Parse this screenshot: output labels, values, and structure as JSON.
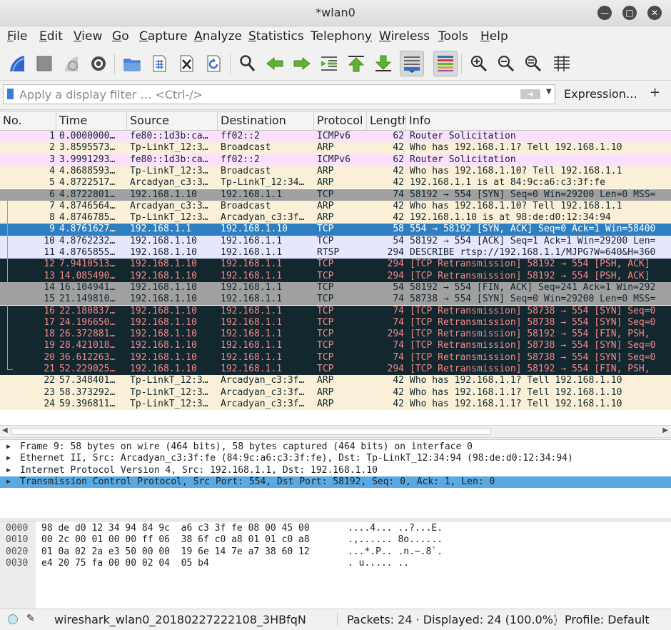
{
  "window": {
    "title": "*wlan0"
  },
  "menu": [
    {
      "label": "File",
      "u": "F",
      "rest": "ile"
    },
    {
      "label": "Edit",
      "u": "E",
      "rest": "dit"
    },
    {
      "label": "View",
      "u": "V",
      "rest": "iew"
    },
    {
      "label": "Go",
      "u": "G",
      "rest": "o"
    },
    {
      "label": "Capture",
      "u": "C",
      "rest": "apture"
    },
    {
      "label": "Analyze",
      "u": "A",
      "rest": "nalyze"
    },
    {
      "label": "Statistics",
      "u": "S",
      "rest": "tatistics"
    },
    {
      "label": "Telephony",
      "u": "y",
      "rest": ""
    },
    {
      "label": "Wireless",
      "u": "W",
      "rest": "ireless"
    },
    {
      "label": "Tools",
      "u": "T",
      "rest": "ools"
    },
    {
      "label": "Help",
      "u": "H",
      "rest": "elp"
    }
  ],
  "toolbar": [
    "start-capture-icon",
    "stop-capture-icon",
    "restart-capture-icon",
    "capture-options-icon",
    "open-file-icon",
    "save-file-icon",
    "close-file-icon",
    "reload-file-icon",
    "find-packet-icon",
    "go-back-icon",
    "go-forward-icon",
    "go-to-packet-icon",
    "first-packet-icon",
    "last-packet-icon",
    "autoscroll-icon",
    "colorize-icon",
    "zoom-in-icon",
    "zoom-out-icon",
    "normal-size-icon",
    "resize-columns-icon"
  ],
  "filter": {
    "placeholder": "Apply a display filter … <Ctrl-/>",
    "expression_label": "Expression…",
    "plus_label": "+"
  },
  "columns": {
    "no": "No.",
    "time": "Time",
    "source": "Source",
    "destination": "Destination",
    "protocol": "Protocol",
    "length": "Length",
    "info": "Info"
  },
  "colors": {
    "icmpv6": "#fce0ff",
    "arp": "#faf0d7",
    "tcp": "#e7e6ff",
    "tcp_handshake": "#a0a0a0",
    "bad": "#12272e",
    "bad_text": "#f78787",
    "fin": "#a0a0a0",
    "selected": "#2d7fc1"
  },
  "packets": [
    {
      "no": "1",
      "time": "0.0000000…",
      "src": "fe80::1d3b:ca…",
      "dst": "ff02::2",
      "proto": "ICMPv6",
      "len": "62",
      "info": "Router Solicitation",
      "style": "icmpv6"
    },
    {
      "no": "2",
      "time": "3.8595573…",
      "src": "Tp-LinkT_12:3…",
      "dst": "Broadcast",
      "proto": "ARP",
      "len": "42",
      "info": "Who has 192.168.1.1? Tell 192.168.1.10",
      "style": "arp"
    },
    {
      "no": "3",
      "time": "3.9991293…",
      "src": "fe80::1d3b:ca…",
      "dst": "ff02::2",
      "proto": "ICMPv6",
      "len": "62",
      "info": "Router Solicitation",
      "style": "icmpv6"
    },
    {
      "no": "4",
      "time": "4.8688593…",
      "src": "Tp-LinkT_12:3…",
      "dst": "Broadcast",
      "proto": "ARP",
      "len": "42",
      "info": "Who has 192.168.1.10? Tell 192.168.1.1",
      "style": "arp"
    },
    {
      "no": "5",
      "time": "4.8722517…",
      "src": "Arcadyan_c3:3…",
      "dst": "Tp-LinkT_12:34…",
      "proto": "ARP",
      "len": "42",
      "info": "192.168.1.1 is at 84:9c:a6:c3:3f:fe",
      "style": "arp"
    },
    {
      "no": "6",
      "time": "4.8722801…",
      "src": "192.168.1.10",
      "dst": "192.168.1.1",
      "proto": "TCP",
      "len": "74",
      "info": "58192 → 554 [SYN] Seq=0 Win=29200 Len=0 MSS=",
      "style": "tcp_handshake"
    },
    {
      "no": "7",
      "time": "4.8746564…",
      "src": "Arcadyan_c3:3…",
      "dst": "Broadcast",
      "proto": "ARP",
      "len": "42",
      "info": "Who has 192.168.1.10? Tell 192.168.1.1",
      "style": "arp"
    },
    {
      "no": "8",
      "time": "4.8746785…",
      "src": "Tp-LinkT_12:3…",
      "dst": "Arcadyan_c3:3f…",
      "proto": "ARP",
      "len": "42",
      "info": "192.168.1.10 is at 98:de:d0:12:34:94",
      "style": "arp"
    },
    {
      "no": "9",
      "time": "4.8761627…",
      "src": "192.168.1.1",
      "dst": "192.168.1.10",
      "proto": "TCP",
      "len": "58",
      "info": "554 → 58192 [SYN, ACK] Seq=0 Ack=1 Win=58400",
      "style": "selected"
    },
    {
      "no": "10",
      "time": "4.8762232…",
      "src": "192.168.1.10",
      "dst": "192.168.1.1",
      "proto": "TCP",
      "len": "54",
      "info": "58192 → 554 [ACK] Seq=1 Ack=1 Win=29200 Len=",
      "style": "tcp"
    },
    {
      "no": "11",
      "time": "4.8765855…",
      "src": "192.168.1.10",
      "dst": "192.168.1.1",
      "proto": "RTSP",
      "len": "294",
      "info": "DESCRIBE rtsp://192.168.1.1/MJPG?W=640&H=360",
      "style": "tcp"
    },
    {
      "no": "12",
      "time": "7.9410513…",
      "src": "192.168.1.10",
      "dst": "192.168.1.1",
      "proto": "TCP",
      "len": "294",
      "info": "[TCP Retransmission] 58192 → 554 [PSH, ACK]",
      "style": "bad"
    },
    {
      "no": "13",
      "time": "14.085490…",
      "src": "192.168.1.10",
      "dst": "192.168.1.1",
      "proto": "TCP",
      "len": "294",
      "info": "[TCP Retransmission] 58192 → 554 [PSH, ACK]",
      "style": "bad"
    },
    {
      "no": "14",
      "time": "16.104941…",
      "src": "192.168.1.10",
      "dst": "192.168.1.1",
      "proto": "TCP",
      "len": "54",
      "info": "58192 → 554 [FIN, ACK] Seq=241 Ack=1 Win=292",
      "style": "fin"
    },
    {
      "no": "15",
      "time": "21.149810…",
      "src": "192.168.1.10",
      "dst": "192.168.1.1",
      "proto": "TCP",
      "len": "74",
      "info": "58738 → 554 [SYN] Seq=0 Win=29200 Len=0 MSS=",
      "style": "fin"
    },
    {
      "no": "16",
      "time": "22.180837…",
      "src": "192.168.1.10",
      "dst": "192.168.1.1",
      "proto": "TCP",
      "len": "74",
      "info": "[TCP Retransmission] 58738 → 554 [SYN] Seq=0",
      "style": "bad"
    },
    {
      "no": "17",
      "time": "24.196650…",
      "src": "192.168.1.10",
      "dst": "192.168.1.1",
      "proto": "TCP",
      "len": "74",
      "info": "[TCP Retransmission] 58738 → 554 [SYN] Seq=0",
      "style": "bad"
    },
    {
      "no": "18",
      "time": "26.372881…",
      "src": "192.168.1.10",
      "dst": "192.168.1.1",
      "proto": "TCP",
      "len": "294",
      "info": "[TCP Retransmission] 58192 → 554 [FIN, PSH,",
      "style": "bad"
    },
    {
      "no": "19",
      "time": "28.421018…",
      "src": "192.168.1.10",
      "dst": "192.168.1.1",
      "proto": "TCP",
      "len": "74",
      "info": "[TCP Retransmission] 58738 → 554 [SYN] Seq=0",
      "style": "bad"
    },
    {
      "no": "20",
      "time": "36.612263…",
      "src": "192.168.1.10",
      "dst": "192.168.1.1",
      "proto": "TCP",
      "len": "74",
      "info": "[TCP Retransmission] 58738 → 554 [SYN] Seq=0",
      "style": "bad"
    },
    {
      "no": "21",
      "time": "52.229025…",
      "src": "192.168.1.10",
      "dst": "192.168.1.1",
      "proto": "TCP",
      "len": "294",
      "info": "[TCP Retransmission] 58192 → 554 [FIN, PSH,",
      "style": "bad"
    },
    {
      "no": "22",
      "time": "57.348401…",
      "src": "Tp-LinkT_12:3…",
      "dst": "Arcadyan_c3:3f…",
      "proto": "ARP",
      "len": "42",
      "info": "Who has 192.168.1.1? Tell 192.168.1.10",
      "style": "arp"
    },
    {
      "no": "23",
      "time": "58.373292…",
      "src": "Tp-LinkT_12:3…",
      "dst": "Arcadyan_c3:3f…",
      "proto": "ARP",
      "len": "42",
      "info": "Who has 192.168.1.1? Tell 192.168.1.10",
      "style": "arp"
    },
    {
      "no": "24",
      "time": "59.396811…",
      "src": "Tp-LinkT_12:3…",
      "dst": "Arcadyan_c3:3f…",
      "proto": "ARP",
      "len": "42",
      "info": "Who has 192.168.1.1? Tell 192.168.1.10",
      "style": "arp"
    }
  ],
  "details": [
    {
      "text": "Frame 9: 58 bytes on wire (464 bits), 58 bytes captured (464 bits) on interface 0",
      "selected": false
    },
    {
      "text": "Ethernet II, Src: Arcadyan_c3:3f:fe (84:9c:a6:c3:3f:fe), Dst: Tp-LinkT_12:34:94 (98:de:d0:12:34:94)",
      "selected": false
    },
    {
      "text": "Internet Protocol Version 4, Src: 192.168.1.1, Dst: 192.168.1.10",
      "selected": false
    },
    {
      "text": "Transmission Control Protocol, Src Port: 554, Dst Port: 58192, Seq: 0, Ack: 1, Len: 0",
      "selected": true
    }
  ],
  "bytes": [
    {
      "offset": "0000",
      "hex": "98 de d0 12 34 94 84 9c  a6 c3 3f fe 08 00 45 00",
      "ascii": "....4... ..?...E."
    },
    {
      "offset": "0010",
      "hex": "00 2c 00 01 00 00 ff 06  38 6f c0 a8 01 01 c0 a8",
      "ascii": ".,...... 8o......"
    },
    {
      "offset": "0020",
      "hex": "01 0a 02 2a e3 50 00 00  19 6e 14 7e a7 38 60 12",
      "ascii": "...*.P.. .n.~.8`."
    },
    {
      "offset": "0030",
      "hex": "e4 20 75 fa 00 00 02 04  05 b4",
      "ascii": ". u..... .."
    }
  ],
  "status": {
    "file": "wireshark_wlan0_20180227222108_3HBfqN",
    "packets": "Packets: 24 · Displayed: 24 (100.0%)",
    "profile": "Profile: Default"
  }
}
